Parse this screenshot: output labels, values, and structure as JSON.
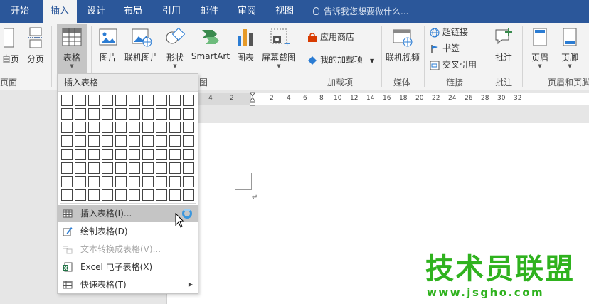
{
  "tabs": [
    {
      "label": "开始",
      "active": false
    },
    {
      "label": "插入",
      "active": true
    },
    {
      "label": "设计",
      "active": false
    },
    {
      "label": "布局",
      "active": false
    },
    {
      "label": "引用",
      "active": false
    },
    {
      "label": "邮件",
      "active": false
    },
    {
      "label": "审阅",
      "active": false
    },
    {
      "label": "视图",
      "active": false
    }
  ],
  "tell_me": "告诉我您想要做什么...",
  "ribbon": {
    "pages": {
      "blank_page": "白页",
      "page_break": "分页",
      "group": "页面"
    },
    "table": {
      "label": "表格"
    },
    "illustrations": {
      "picture": "图片",
      "online_picture": "联机图片",
      "shapes": "形状",
      "smartart": "SmartArt",
      "chart": "图表",
      "screenshot": "屏幕截图",
      "group_tail": "图"
    },
    "addins": {
      "store": "应用商店",
      "my_addins": "我的加载项",
      "group": "加载项"
    },
    "media": {
      "online_video": "联机视频",
      "group": "媒体"
    },
    "links": {
      "hyperlink": "超链接",
      "bookmark": "书签",
      "cross_ref": "交叉引用",
      "group": "链接"
    },
    "comments": {
      "comment": "批注",
      "group": "批注"
    },
    "header_footer": {
      "header": "页眉",
      "footer": "页脚",
      "group": "页眉和页脚"
    }
  },
  "ruler_ticks": [
    "4",
    "4",
    "2",
    "2",
    "4",
    "6",
    "8",
    "10",
    "12",
    "14",
    "16",
    "18",
    "20",
    "22",
    "24",
    "26",
    "28",
    "30",
    "32"
  ],
  "insert_table_menu": {
    "title": "插入表格",
    "grid": {
      "columns": 10,
      "rows": 8
    },
    "items": [
      {
        "label": "插入表格(I)...",
        "state": "hover"
      },
      {
        "label": "绘制表格(D)",
        "state": "normal"
      },
      {
        "label": "文本转换成表格(V)...",
        "state": "disabled"
      },
      {
        "label": "Excel 电子表格(X)",
        "state": "normal"
      },
      {
        "label": "快速表格(T)",
        "state": "normal",
        "submenu": true
      }
    ]
  },
  "paragraph_mark": "↵",
  "watermark": {
    "text": "技术员联盟",
    "url": "www.jsgho.com"
  },
  "colors": {
    "tab_bar": "#2b579a",
    "ribbon": "#f3f3f3",
    "hover": "#c5c5c5",
    "watermark": "#2fb21e",
    "accent_blue": "#3a96dd"
  }
}
